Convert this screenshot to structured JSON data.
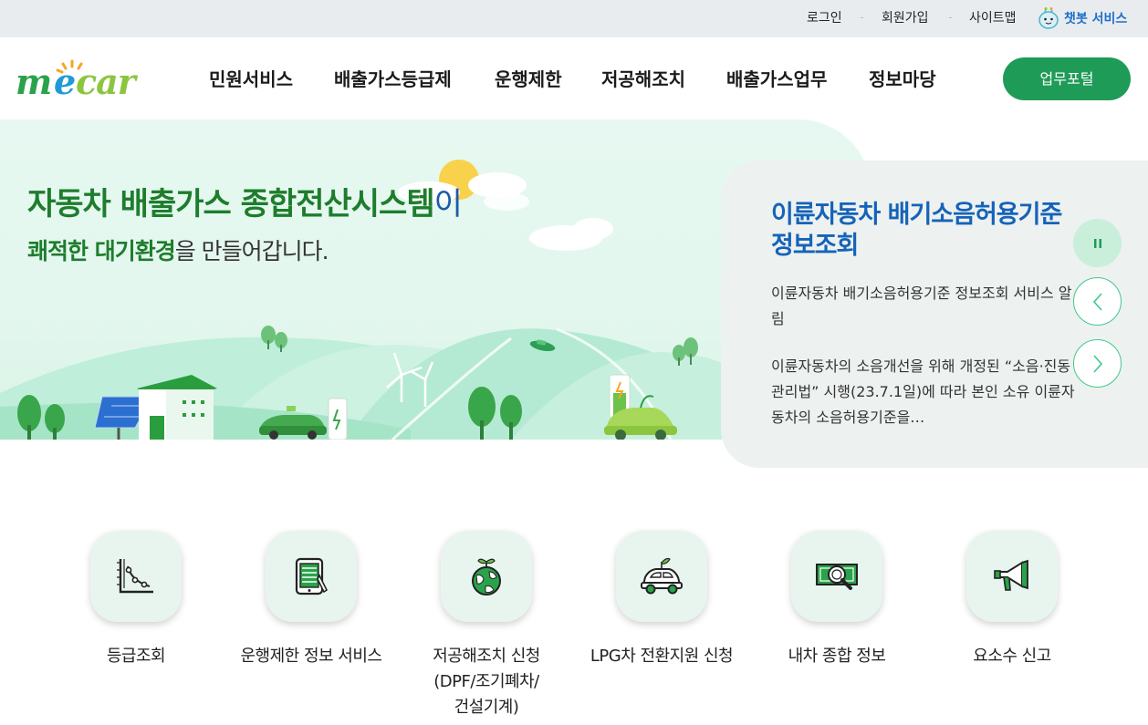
{
  "topbar": {
    "login": "로그인",
    "signup": "회원가입",
    "sitemap": "사이트맵",
    "chatbot": "챗봇 서비스"
  },
  "header": {
    "logo_text": "mecar",
    "nav": [
      "민원서비스",
      "배출가스등급제",
      "운행제한",
      "저공해조치",
      "배출가스업무",
      "정보마당"
    ],
    "portal_button": "업무포털"
  },
  "hero": {
    "title_main": "자동차 배출가스 종합전산시스템",
    "title_suffix": "이",
    "sub_strong": "쾌적한 대기환경",
    "sub_rest": "을 만들어갑니다."
  },
  "notice": {
    "title": "이륜자동차 배기소음허용기준 정보조회",
    "items": [
      "이륜자동차 배기소음허용기준 정보조회 서비스 알림",
      "이륜자동차의 소음개선을 위해 개정된 “소음·진동 관리법” 시행(23.7.1일)에 따라 본인 소유 이륜자동차의 소음허용기준을…"
    ]
  },
  "quick_menu": [
    {
      "label": "등급조회",
      "icon": "grade-chart-icon"
    },
    {
      "label": "운행제한 정보 서비스",
      "icon": "tablet-icon"
    },
    {
      "label": "저공해조치 신청\n(DPF/조기폐차/\n건설기계)",
      "icon": "globe-sprout-icon"
    },
    {
      "label": "LPG차 전환지원 신청",
      "icon": "eco-car-icon"
    },
    {
      "label": "내차 종합 정보",
      "icon": "money-search-icon"
    },
    {
      "label": "요소수 신고",
      "icon": "megaphone-icon"
    }
  ],
  "colors": {
    "brand_green": "#1f9b58",
    "hero_title_green": "#1e7d2c",
    "notice_blue": "#1563b8",
    "topbar_bg": "#e9ecef"
  }
}
